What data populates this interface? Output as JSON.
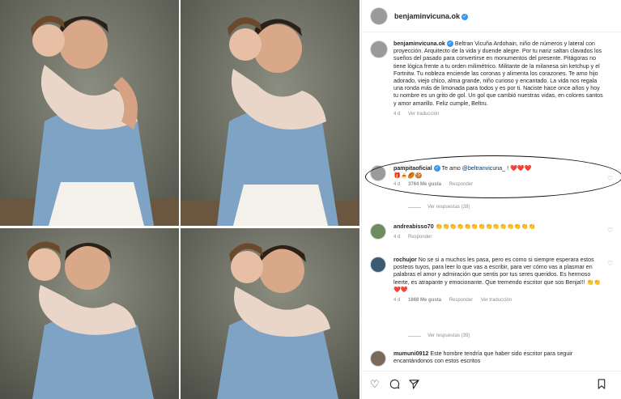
{
  "post": {
    "username": "benjaminvicuna.ok",
    "caption": "Beltran Vicuña Ardohain, niño de números y lateral con proyección. Arquitecto de la vida y duende alegre. Por tu nariz saltan clavados los sueños del pasado para convertirse en monumentos del presente. Pitágoras no tiene lógica frente a tu orden milimétrico. Militante de la milanesa sin ketchup y el Fortnitw. Tu nobleza enciende las coronas y alimenta los corazones. Te amo hijo adorado, viejo chico, alma grande, niño curioso y encantado. La vida nos regala una ronda más de limonada para todos y es por ti. Naciste hace once años y hoy tu nombre es un grito de gol. Un gol que cambió nuestras vidas, en colores santos y amor amarillo. Feliz cumple, Beltru.",
    "time": "4 d",
    "translate": "Ver traducción"
  },
  "comments": [
    {
      "username": "pampitaoficial",
      "text_before": "Te amo ",
      "mention": "@beltranvicuna_",
      "text_after": " ! ❤️❤️❤️",
      "emoji_line": "🎁🍝🏉🍪",
      "time": "4 d",
      "likes": "3764 Me gusta",
      "reply": "Responder",
      "replies_link": "Ver respuestas (28)"
    },
    {
      "username": "andreabisso70",
      "text": "👏👏👏👏👏👏👏👏👏👏👏👏👏👏",
      "time": "4 d",
      "reply": "Responder"
    },
    {
      "username": "rochujor",
      "text": "No se si a muchos les pasa, pero es como si siempre esperara estos posteos tuyos, para leer lo que vas a escribir, para ver cómo vas a plasmar en palabras el amor y admiración que sentis por tus seres queridos. Es hermoso leerte, es atrapante y emocionante. Que tremendo escritor que sos Benja!!! 👏👏❤️❤️",
      "time": "4 d",
      "likes": "1868 Me gusta",
      "reply": "Responder",
      "translate": "Ver traducción",
      "replies_link": "Ver respuestas (39)"
    },
    {
      "username": "mumuni0912",
      "text": "Este hombre tendría que haber sido escritor para seguir encantándonos con estos escritos"
    }
  ],
  "icons": {
    "heart": "heart-icon",
    "comment": "comment-icon",
    "share": "share-icon",
    "bookmark": "bookmark-icon",
    "verified": "verified-badge"
  },
  "colors": {
    "link": "#00376b",
    "meta": "#8e8e8e",
    "verified": "#3897f0"
  }
}
